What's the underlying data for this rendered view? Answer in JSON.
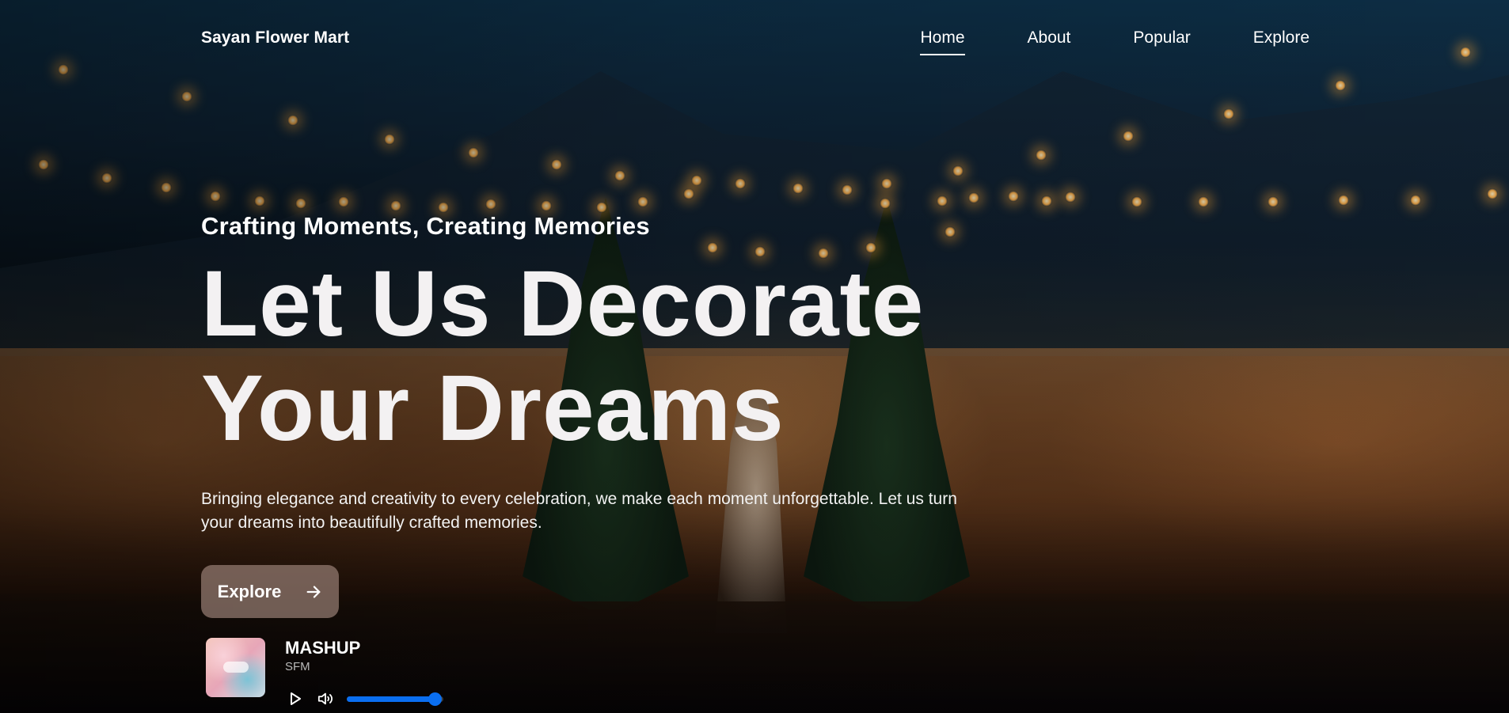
{
  "header": {
    "brand": "Sayan Flower Mart",
    "nav": [
      {
        "label": "Home",
        "active": true
      },
      {
        "label": "About",
        "active": false
      },
      {
        "label": "Popular",
        "active": false
      },
      {
        "label": "Explore",
        "active": false
      }
    ]
  },
  "hero": {
    "tagline": "Crafting Moments, Creating Memories",
    "headline_line1": "Let Us Decorate",
    "headline_line2": "Your Dreams",
    "description": "Bringing elegance and creativity to every celebration, we make each moment unforgettable. Let us turn your dreams into beautifully crafted memories.",
    "cta_label": "Explore",
    "cta_icon": "arrow-right-icon"
  },
  "player": {
    "title": "MASHUP",
    "artist": "SFM",
    "play_icon": "play-icon",
    "volume_icon": "volume-icon",
    "volume_level": 0.91,
    "accent_color": "#0a6ef0"
  },
  "colors": {
    "cta_background": "#967d73",
    "text": "#ffffff",
    "muted_text": "#b9b9b9"
  }
}
